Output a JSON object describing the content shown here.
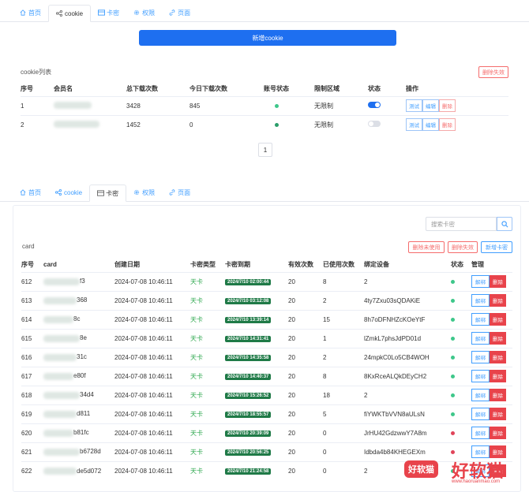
{
  "top_tabs": [
    {
      "label": "首页",
      "icon": "home-icon",
      "active": false
    },
    {
      "label": "cookie",
      "icon": "share-icon",
      "active": true
    },
    {
      "label": "卡密",
      "icon": "card-icon",
      "active": false
    },
    {
      "label": "权限",
      "icon": "gear-icon",
      "active": false
    },
    {
      "label": "页面",
      "icon": "link-icon",
      "active": false
    }
  ],
  "cookie_panel": {
    "add_button": "新增cookie",
    "list_title": "cookie列表",
    "delete_invalid": "删除失效",
    "columns": [
      "序号",
      "会员名",
      "总下载次数",
      "今日下载次数",
      "账号状态",
      "限制区域",
      "状态",
      "操作"
    ],
    "rows": [
      {
        "no": "1",
        "member": "",
        "total": "3428",
        "today": "845",
        "account_status_color": "#3ec78a",
        "region": "无限制",
        "enabled": true
      },
      {
        "no": "2",
        "member": "",
        "total": "1452",
        "today": "0",
        "account_status_color": "#2a9d6a",
        "region": "无限制",
        "enabled": false
      }
    ],
    "ops": {
      "test": "测试",
      "edit": "编辑",
      "delete": "删除"
    },
    "page": "1"
  },
  "second_tabs": [
    {
      "label": "首页",
      "icon": "home-icon",
      "active": false
    },
    {
      "label": "cookie",
      "icon": "share-icon",
      "active": false
    },
    {
      "label": "卡密",
      "icon": "card-icon",
      "active": true
    },
    {
      "label": "权限",
      "icon": "gear-icon",
      "active": false
    },
    {
      "label": "页面",
      "icon": "link-icon",
      "active": false
    }
  ],
  "card_panel": {
    "search_placeholder": "搜索卡密",
    "title": "card",
    "delete_unused": "删除未使用",
    "delete_invalid": "删除失效",
    "add_card": "新增卡密",
    "columns": [
      "序号",
      "card",
      "创建日期",
      "卡密类型",
      "卡密到期",
      "有效次数",
      "已使用次数",
      "绑定设备",
      "状态",
      "管理"
    ],
    "unbind": "解绑",
    "delete": "删除",
    "rows": [
      {
        "no": "612",
        "card_suffix": "f3",
        "created": "2024-07-08 10:46:11",
        "type": "天卡",
        "expire": "2024/7/10 02:00:44",
        "valid": "20",
        "used": "8",
        "device": "2",
        "status_color": "#3ec78a"
      },
      {
        "no": "613",
        "card_suffix": "368",
        "created": "2024-07-08 10:46:11",
        "type": "天卡",
        "expire": "2024/7/10 03:12:08",
        "valid": "20",
        "used": "2",
        "device": "4ty7Zxu03sQDAKiE",
        "status_color": "#3ec78a"
      },
      {
        "no": "614",
        "card_suffix": "8c",
        "created": "2024-07-08 10:46:11",
        "type": "天卡",
        "expire": "2024/7/10 13:39:14",
        "valid": "20",
        "used": "15",
        "device": "8h7oDFNHZcKOeYtF",
        "status_color": "#3ec78a"
      },
      {
        "no": "615",
        "card_suffix": "8e",
        "created": "2024-07-08 10:46:11",
        "type": "天卡",
        "expire": "2024/7/10 14:31:41",
        "valid": "20",
        "used": "1",
        "device": "lZmkL7phsJdPD01d",
        "status_color": "#3ec78a"
      },
      {
        "no": "616",
        "card_suffix": "31c",
        "created": "2024-07-08 10:46:11",
        "type": "天卡",
        "expire": "2024/7/10 14:35:58",
        "valid": "20",
        "used": "2",
        "device": "24mpkC0Lo5CB4WOH",
        "status_color": "#3ec78a"
      },
      {
        "no": "617",
        "card_suffix": "e80f",
        "created": "2024-07-08 10:46:11",
        "type": "天卡",
        "expire": "2024/7/10 14:40:37",
        "valid": "20",
        "used": "8",
        "device": "8KxRceALQkDEyCH2",
        "status_color": "#3ec78a"
      },
      {
        "no": "618",
        "card_suffix": "34d4",
        "created": "2024-07-08 10:46:11",
        "type": "天卡",
        "expire": "2024/7/10 15:26:52",
        "valid": "20",
        "used": "18",
        "device": "2",
        "status_color": "#3ec78a"
      },
      {
        "no": "619",
        "card_suffix": "d811",
        "created": "2024-07-08 10:46:11",
        "type": "天卡",
        "expire": "2024/7/10 18:55:57",
        "valid": "20",
        "used": "5",
        "device": "fiYWKTbVVN8aULsN",
        "status_color": "#3ec78a"
      },
      {
        "no": "620",
        "card_suffix": "b81fc",
        "created": "2024-07-08 10:46:11",
        "type": "天卡",
        "expire": "2024/7/10 20:39:09",
        "valid": "20",
        "used": "0",
        "device": "JrHU42GdzwwY7A8m",
        "status_color": "#e0445a"
      },
      {
        "no": "621",
        "card_suffix": "b6728d",
        "created": "2024-07-08 10:46:11",
        "type": "天卡",
        "expire": "2024/7/10 20:56:25",
        "valid": "20",
        "used": "0",
        "device": "Idbda4b84KHEGEXm",
        "status_color": "#e0445a"
      },
      {
        "no": "622",
        "card_suffix": "de5d072",
        "created": "2024-07-08 10:46:11",
        "type": "天卡",
        "expire": "2024/7/10 21:24:58",
        "valid": "20",
        "used": "0",
        "device": "2",
        "status_color": "#3ec78a"
      }
    ]
  },
  "watermark": {
    "badge": "好软猫",
    "big": "好软猫",
    "url": "www.haoruanmao.com",
    "color": "#e8434b"
  }
}
